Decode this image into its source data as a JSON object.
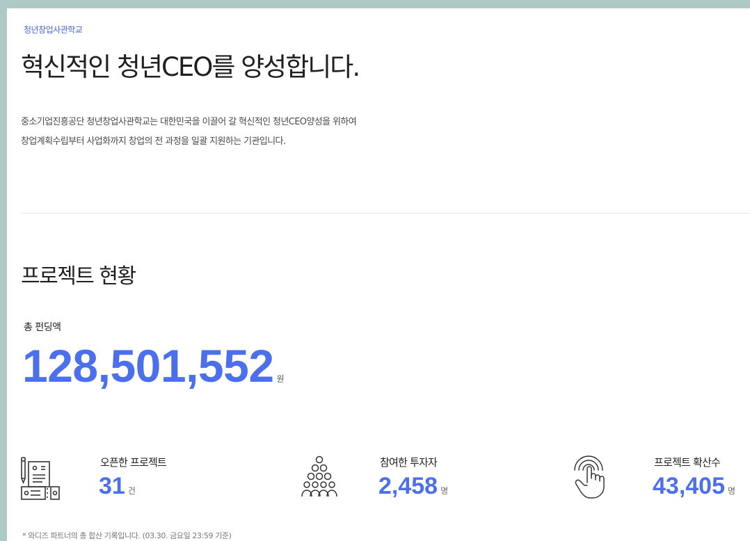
{
  "header": {
    "eyebrow": "청년창업사관학교",
    "headline": "혁신적인 청년CEO를 양성합니다.",
    "description_lines": [
      "중소기업진흥공단 청년창업사관학교는 대한민국을 이끌어 갈 혁신적인 청년CEO양성을 위하여",
      "창업계획수립부터 사업화까지 창업의 전 과정을 일괄 지원하는 기관입니다."
    ]
  },
  "project_status": {
    "title": "프로젝트 현황",
    "total_funding": {
      "label": "총 펀딩액",
      "value": "128,501,552",
      "unit": "원"
    },
    "stats": [
      {
        "icon": "document-icon",
        "label": "오픈한 프로젝트",
        "value": "31",
        "unit": "건"
      },
      {
        "icon": "people-group-icon",
        "label": "참여한 투자자",
        "value": "2,458",
        "unit": "명"
      },
      {
        "icon": "touch-hand-icon",
        "label": "프로젝트 확산수",
        "value": "43,405",
        "unit": "명"
      }
    ],
    "footnote": "* 와디즈 파트너의 총 합산 기록입니다. (03.30. 금요일 23:59 기준)"
  },
  "colors": {
    "accent": "#4c6fee",
    "eyebrow": "#4a63d8",
    "frame": "#aec9c6"
  }
}
